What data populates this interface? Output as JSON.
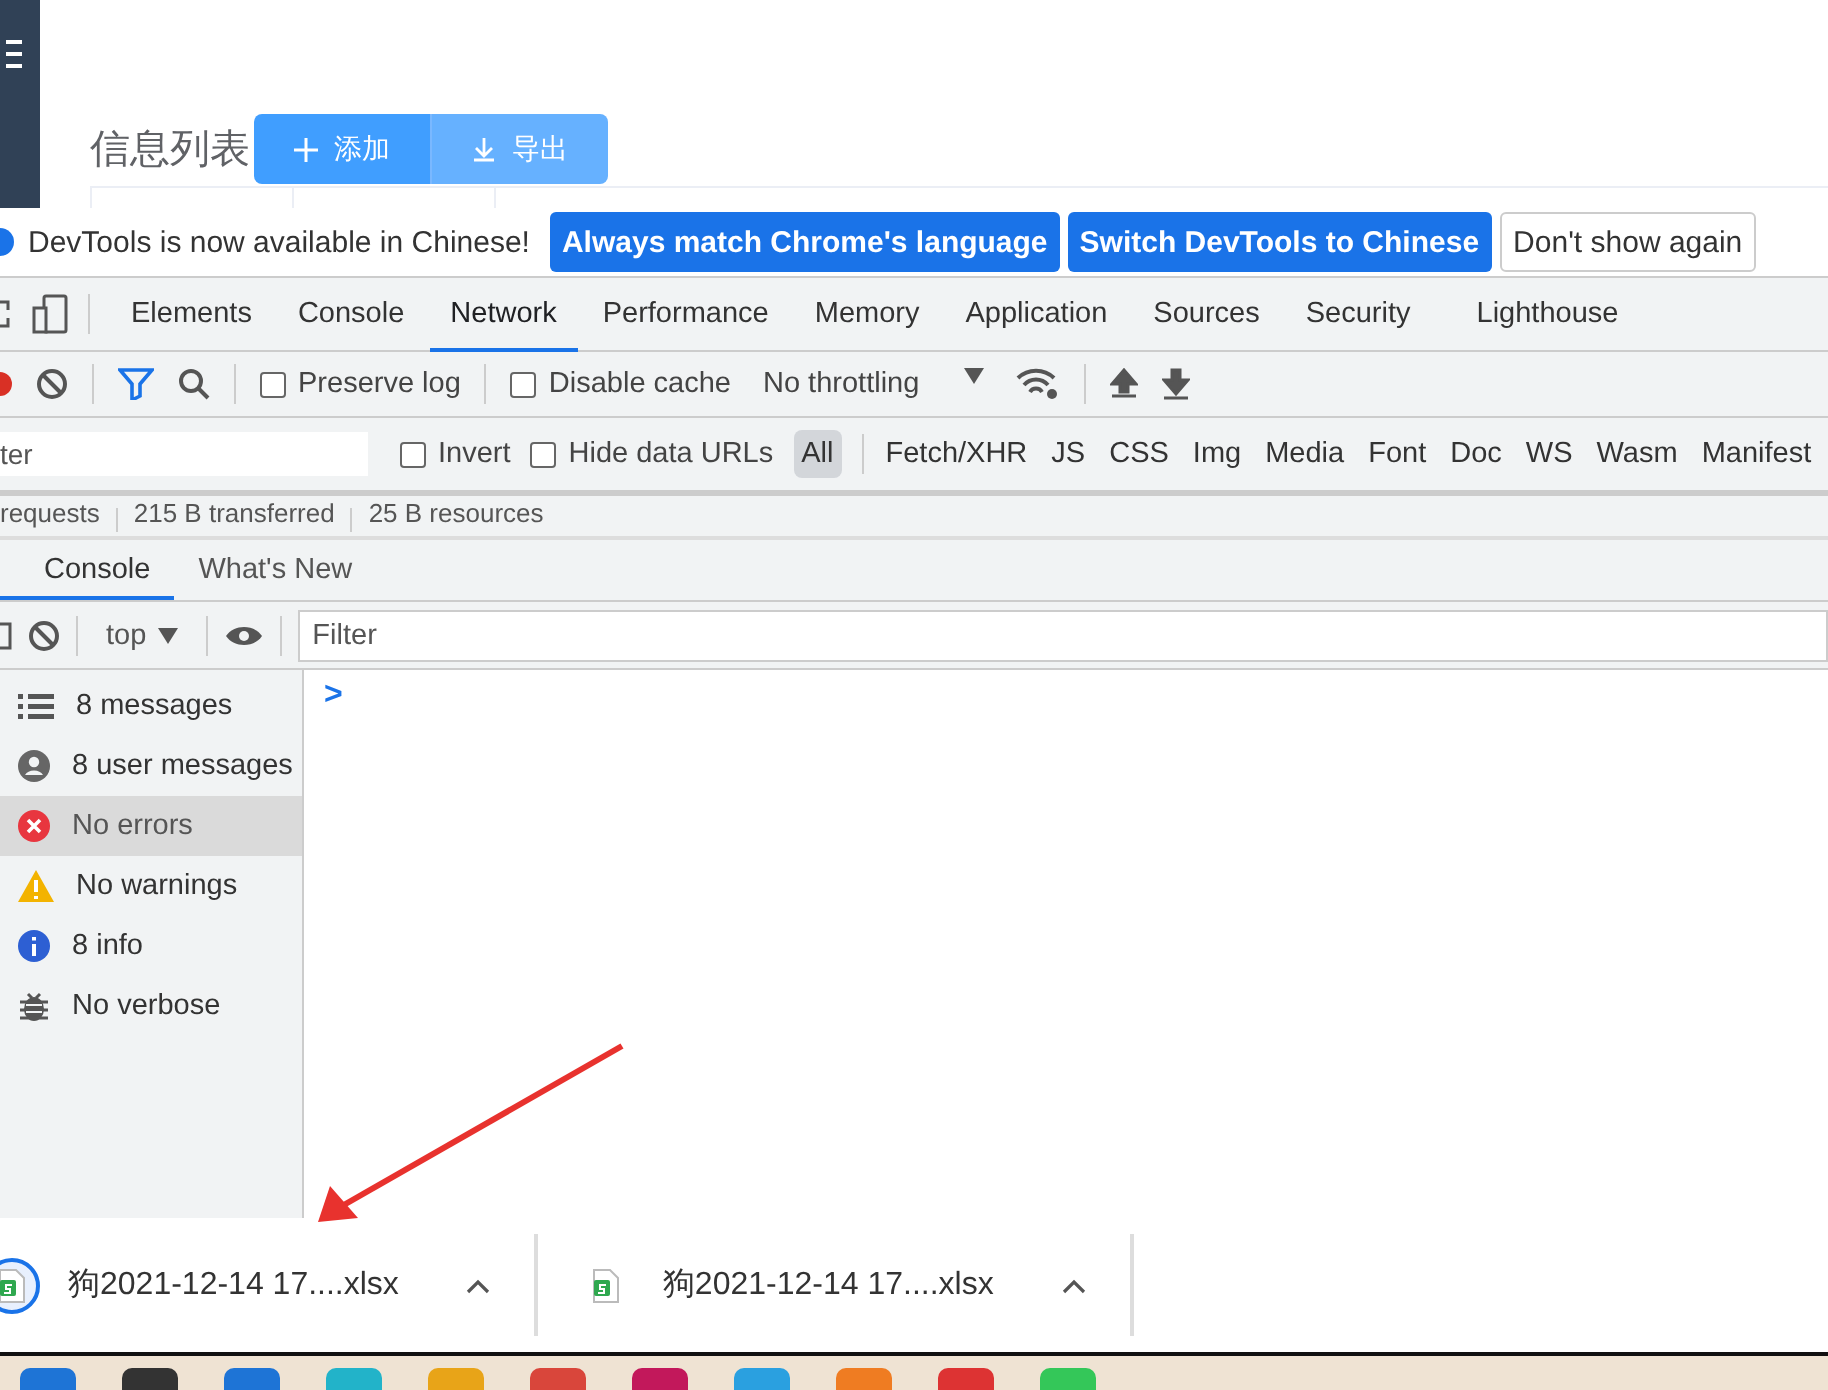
{
  "page": {
    "title": "信息列表",
    "buttons": [
      {
        "kind": "add",
        "label": "添加"
      },
      {
        "kind": "export",
        "label": "导出"
      }
    ]
  },
  "infobar": {
    "message": "DevTools is now available in Chinese!",
    "buttons": [
      {
        "label": "Always match Chrome's language",
        "kind": "primary"
      },
      {
        "label": "Switch DevTools to Chinese",
        "kind": "primary"
      },
      {
        "label": "Don't show again",
        "kind": "plain"
      }
    ]
  },
  "tabs": [
    {
      "label": "Elements",
      "selected": false
    },
    {
      "label": "Console",
      "selected": false
    },
    {
      "label": "Network",
      "selected": true
    },
    {
      "label": "Performance",
      "selected": false
    },
    {
      "label": "Memory",
      "selected": false
    },
    {
      "label": "Application",
      "selected": false
    },
    {
      "label": "Sources",
      "selected": false
    },
    {
      "label": "Security",
      "selected": false
    },
    {
      "label": "Lighthouse",
      "selected": false
    }
  ],
  "network_toolbar": {
    "preserve_log": {
      "label": "Preserve log",
      "checked": false
    },
    "disable_cache": {
      "label": "Disable cache",
      "checked": false
    },
    "throttling": "No throttling"
  },
  "filter_bar": {
    "placeholder": "ter",
    "invert": {
      "label": "Invert",
      "checked": false
    },
    "hide_data_urls": {
      "label": "Hide data URLs",
      "checked": false
    },
    "types": [
      {
        "label": "All",
        "selected": true
      },
      {
        "label": "Fetch/XHR",
        "selected": false
      },
      {
        "label": "JS",
        "selected": false
      },
      {
        "label": "CSS",
        "selected": false
      },
      {
        "label": "Img",
        "selected": false
      },
      {
        "label": "Media",
        "selected": false
      },
      {
        "label": "Font",
        "selected": false
      },
      {
        "label": "Doc",
        "selected": false
      },
      {
        "label": "WS",
        "selected": false
      },
      {
        "label": "Wasm",
        "selected": false
      },
      {
        "label": "Manifest",
        "selected": false
      }
    ]
  },
  "summary": [
    "requests",
    "215 B transferred",
    "25 B resources"
  ],
  "drawer_tabs": [
    {
      "label": "Console",
      "selected": true
    },
    {
      "label": "What's New",
      "selected": false
    }
  ],
  "console_toolbar": {
    "context": "top",
    "filter_placeholder": "Filter"
  },
  "console_sidebar": [
    {
      "kind": "messages",
      "label": "8 messages",
      "selected": false
    },
    {
      "kind": "user",
      "label": "8 user messages",
      "selected": false
    },
    {
      "kind": "error",
      "label": "No errors",
      "selected": true
    },
    {
      "kind": "warning",
      "label": "No warnings",
      "selected": false
    },
    {
      "kind": "info",
      "label": "8 info",
      "selected": false
    },
    {
      "kind": "verbose",
      "label": "No verbose",
      "selected": false
    }
  ],
  "console_prompt": ">",
  "downloads": [
    {
      "name": "狗2021-12-14 17....xlsx",
      "selected": true
    },
    {
      "name": "狗2021-12-14 17....xlsx",
      "selected": false
    }
  ]
}
